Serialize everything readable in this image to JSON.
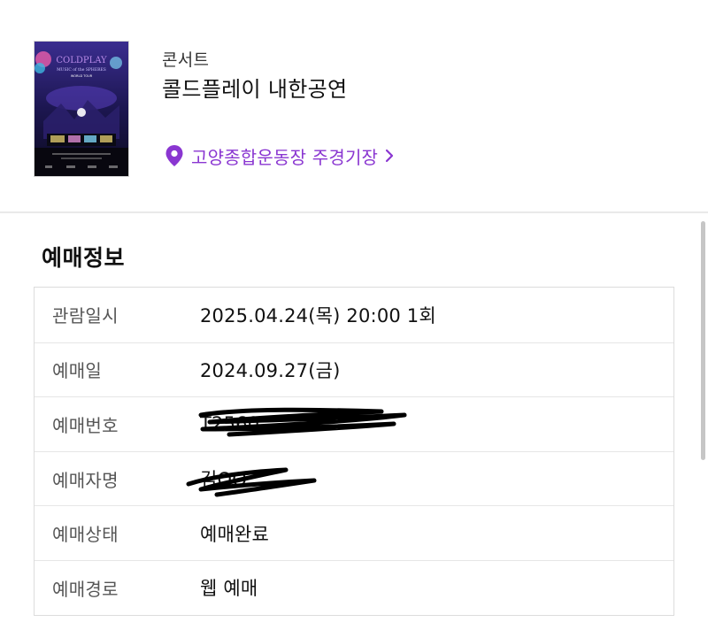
{
  "event": {
    "category": "콘서트",
    "title": "콜드플레이 내한공연",
    "venue": "고양종합운동장 주경기장",
    "poster": {
      "band": "COLDPLAY",
      "tour": "MUSIC of the SPHERES",
      "subtitle": "WORLD TOUR"
    }
  },
  "reservation": {
    "section_title": "예매정보",
    "rows": [
      {
        "label": "관람일시",
        "value": "2025.04.24(목) 20:00 1회"
      },
      {
        "label": "예매일",
        "value": "2024.09.27(금)"
      },
      {
        "label": "예매번호",
        "value": "T2560"
      },
      {
        "label": "예매자명",
        "value": "김OO"
      },
      {
        "label": "예매상태",
        "value": "예매완료"
      },
      {
        "label": "예매경로",
        "value": "웹 예매"
      }
    ]
  },
  "colors": {
    "accent": "#8a36d1",
    "scribble": "#000000"
  },
  "icons": {
    "venue": "location-pin-icon",
    "venue_chevron": "chevron-right-icon"
  }
}
